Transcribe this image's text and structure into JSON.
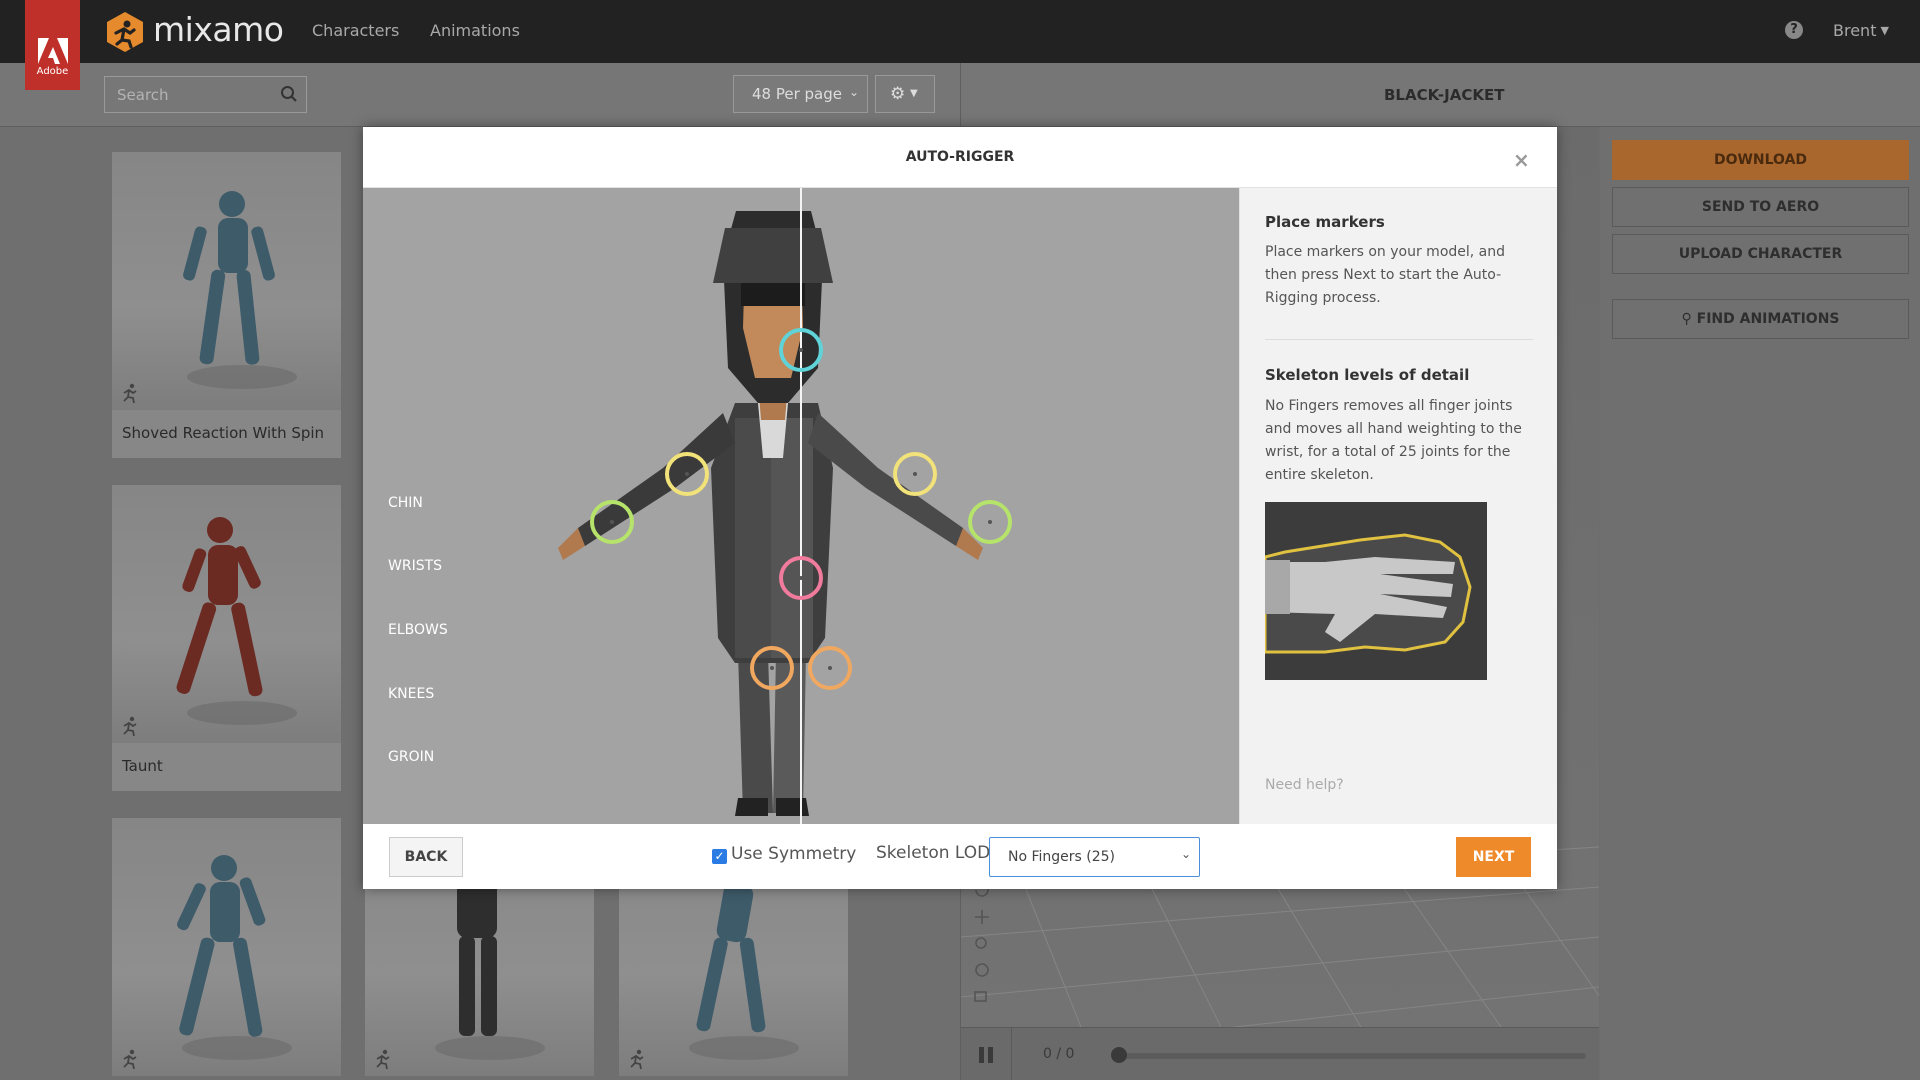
{
  "topbar": {
    "adobe_label": "Adobe",
    "logo_word": "mixamo",
    "nav": [
      {
        "label": "Characters"
      },
      {
        "label": "Animations"
      }
    ],
    "help_glyph": "?",
    "user": "Brent"
  },
  "toolbar": {
    "search_placeholder": "Search",
    "per_page": "48 Per page",
    "character_title": "BLACK-JACKET"
  },
  "grid": {
    "cards": [
      {
        "label": "Shoved Reaction With Spin"
      },
      {
        "label": "Taunt"
      },
      {
        "label": ""
      },
      {
        "label": ""
      },
      {
        "label": ""
      }
    ]
  },
  "sidebar": {
    "buttons": [
      {
        "label": "DOWNLOAD"
      },
      {
        "label": "SEND TO AERO"
      },
      {
        "label": "UPLOAD CHARACTER"
      },
      {
        "label": "FIND ANIMATIONS"
      }
    ]
  },
  "player": {
    "frames": "0 / 0",
    "progress": 0
  },
  "modal": {
    "title": "AUTO-RIGGER",
    "close_glyph": "×",
    "markers": [
      {
        "label": "CHIN",
        "color": "#5fd3d7"
      },
      {
        "label": "WRISTS",
        "color": "#b6e36a"
      },
      {
        "label": "ELBOWS",
        "color": "#f2e27a"
      },
      {
        "label": "KNEES",
        "color": "#f0a860"
      },
      {
        "label": "GROIN",
        "color": "#f07b9c"
      }
    ],
    "info": {
      "heading1": "Place markers",
      "text1": "Place markers on your model, and then press Next to start the Auto-Rigging process.",
      "heading2": "Skeleton levels of detail",
      "text2": "No Fingers removes all finger joints and moves all hand weighting to the wrist, for a total of 25 joints for the entire skeleton.",
      "need_help": "Need help?"
    },
    "footer": {
      "back": "BACK",
      "symmetry_label": "Use Symmetry",
      "symmetry_checked": true,
      "lod_label": "Skeleton LOD",
      "lod_value": "No Fingers (25)",
      "next": "NEXT"
    }
  },
  "colors": {
    "accent": "#ef8a2b",
    "adobe_red": "#c0302a",
    "topbar": "#222222"
  }
}
